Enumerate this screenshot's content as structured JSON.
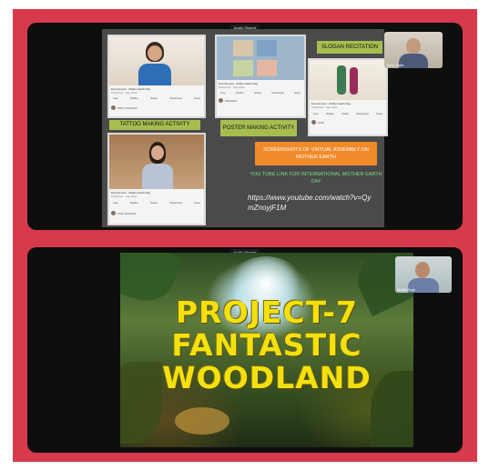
{
  "top_screen": {
    "share_label": "Audio Shared",
    "participant_name": "Sonia Gupta",
    "slide": {
      "shots": [
        {
          "video_title": "Environment · Mother Earth Day",
          "views": "Published · Sep 2021",
          "channel": "ANNY PRSADS",
          "actions": [
            "Like",
            "Dislike",
            "Share",
            "Download",
            "Save"
          ],
          "caption": "TATTOO MAKING ACTIVITY"
        },
        {
          "video_title": "Environment · Mother Earth Day",
          "views": "Published · Sep 2021",
          "channel": "ASHI HASSAN",
          "actions": [
            "Like",
            "Dislike",
            "Share",
            "Download",
            "Save"
          ],
          "caption": ""
        },
        {
          "video_title": "Environment · Mother Earth Day",
          "views": "Published · Sep 2021",
          "channel": "KRISHNA",
          "actions": [
            "Like",
            "Dislike",
            "Share",
            "Download",
            "Save"
          ],
          "caption": "POSTER MAKING ACTIVITY"
        },
        {
          "video_title": "Environment · Mother Earth Day",
          "views": "Published · Sep 2021",
          "channel": "AVNI",
          "actions": [
            "Like",
            "Dislike",
            "Share",
            "Download",
            "Save"
          ],
          "caption": "SLOGAN RECITATION"
        }
      ],
      "orange_box": "SCREENSHOTS OF VIRTUAL ASSEMBLY ON MOTHER EARTH",
      "green_text": "YOU TUBE LINK FOR INTERNATIONAL MOTHER EARTH DAY",
      "link_line1": "https://www.youtube.com/watch?v=Qy",
      "link_line2": "mZnoyjF1M"
    }
  },
  "bottom_screen": {
    "share_label": "Audio Shared",
    "participant_name": "Mohini Singh",
    "title_line1": "PROJECT-7",
    "title_line2": "FANTASTIC",
    "title_line3": "WOODLAND"
  }
}
